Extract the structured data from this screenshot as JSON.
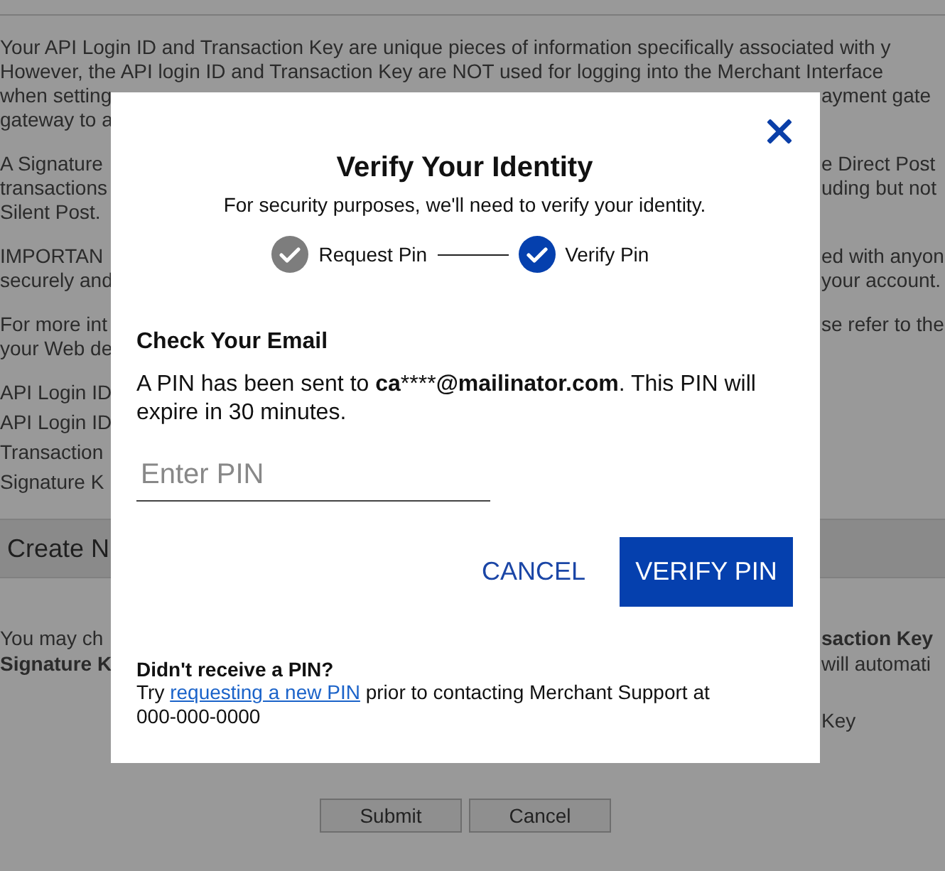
{
  "background": {
    "paragraphs": [
      {
        "lines": [
          {
            "full": "Your API Login ID and Transaction Key are unique pieces of information specifically associated with y"
          },
          {
            "full": "However, the API login ID and Transaction Key are NOT used for logging into the Merchant Interface"
          },
          {
            "left": "when setting",
            "right": "ayment gate"
          },
          {
            "left": "gateway to a"
          }
        ]
      },
      {
        "lines": [
          {
            "left": "A Signature",
            "right": "e Direct Post"
          },
          {
            "left": "transactions",
            "right": "uding but not"
          },
          {
            "left": "Silent Post."
          }
        ]
      },
      {
        "lines": [
          {
            "left": "IMPORTAN",
            "right": "ed with anyon"
          },
          {
            "left": "securely and",
            "right": "your account."
          }
        ]
      },
      {
        "lines": [
          {
            "left": "For more int",
            "right": "se refer to the"
          },
          {
            "left": "your Web de"
          }
        ]
      },
      {
        "kind": "list",
        "lines": [
          {
            "left": "API Login ID"
          },
          {
            "left": "API Login ID"
          },
          {
            "left": "Transaction"
          },
          {
            "left": "Signature K"
          }
        ]
      }
    ],
    "section_title": "Create N",
    "section_lines": [
      {
        "left": "You may ch",
        "right": "saction Key",
        "right_bold": true
      },
      {
        "left": "Signature K",
        "left_bold": true,
        "right": "will automati"
      }
    ],
    "option_line": {
      "right": "Key"
    },
    "buttons": [
      "Submit",
      "Cancel"
    ]
  },
  "dialog": {
    "title": "Verify Your Identity",
    "subtitle": "For security purposes, we'll need to verify your identity.",
    "steps": [
      {
        "label": "Request Pin",
        "selected": false
      },
      {
        "label": "Verify Pin",
        "selected": true
      }
    ],
    "heading": "Check Your Email",
    "message": [
      {
        "kind": "plain",
        "text": "A PIN has been sent to "
      },
      {
        "kind": "strong",
        "text": "ca"
      },
      {
        "kind": "plain",
        "text": "****"
      },
      {
        "kind": "strong",
        "text": "@mailinator.com"
      },
      {
        "kind": "plain",
        "text": ". This PIN will expire in 30 minutes."
      }
    ],
    "pin_field": {
      "placeholder": "Enter PIN"
    },
    "cancel": "CANCEL",
    "verify": "VERIFY PIN",
    "help_title": "Didn't receive a PIN?",
    "help_before": "Try",
    "help_link": "requesting a new PIN",
    "help_after": "prior to contacting Merchant Support at 000-000-0000"
  }
}
